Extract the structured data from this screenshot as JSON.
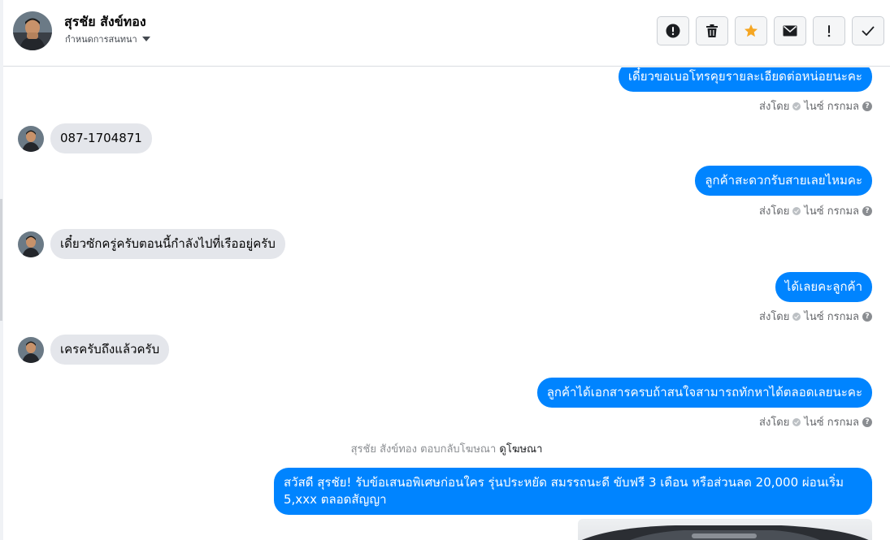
{
  "header": {
    "contact_name": "สุรชัย สังข์ทอง",
    "assign_label": "กำหนดการสนทนา",
    "actions": [
      {
        "icon": "exclamation-circle-icon"
      },
      {
        "icon": "trash-icon"
      },
      {
        "icon": "star-icon"
      },
      {
        "icon": "mail-icon"
      },
      {
        "icon": "exclamation-icon"
      },
      {
        "icon": "check-icon"
      }
    ]
  },
  "colors": {
    "outgoing_bubble": "#0084ff",
    "incoming_bubble": "#e4e6eb",
    "star": "#f5a623"
  },
  "messages": {
    "out1": {
      "text": "เดี๋ยวขอเบอโทรคุยรายละเอียดต่อหน่อยนะคะ",
      "sent_by": "ส่งโดย",
      "sender": "ไนซ์ กรกมล"
    },
    "in1": {
      "text": "087-1704871"
    },
    "out2": {
      "text": "ลูกค้าสะดวกรับสายเลยไหมคะ",
      "sent_by": "ส่งโดย",
      "sender": "ไนซ์ กรกมล"
    },
    "in2": {
      "text": "เดี๋ยวซักครู่ครับตอนนี้กำลังไปที่เรืออยู่ครับ"
    },
    "out3": {
      "text": "ได้เลยคะลูกค้า",
      "sent_by": "ส่งโดย",
      "sender": "ไนซ์ กรกมล"
    },
    "in3": {
      "text": "เครครับถึงแล้วครับ"
    },
    "out4": {
      "text": "ลูกค้าได้เอกสารครบถ้าสนใจสามารถทักหาได้ตลอดเลยนะคะ",
      "sent_by": "ส่งโดย",
      "sender": "ไนซ์ กรกมล"
    },
    "ad_reply": {
      "text": "สุรชัย สังข์ทอง ตอบกลับโฆษณา",
      "link": "ดูโฆษณา"
    },
    "out5": {
      "text": "สวัสดี สุรชัย! รับข้อเสนอพิเศษก่อนใคร รุ่นประหยัด สมรรถนะดี ขับฟรี 3 เดือน หรือส่วนลด 20,000  ผ่อนเริ่ม 5,xxx ตลอดสัญญา"
    }
  }
}
